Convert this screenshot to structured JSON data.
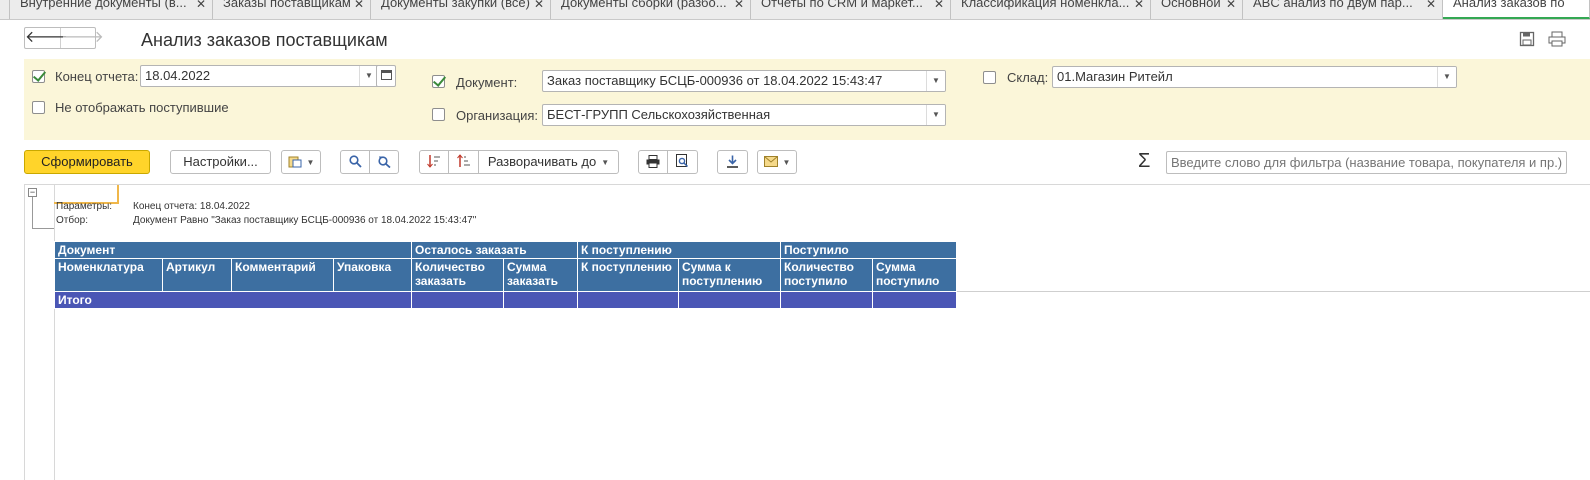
{
  "tabs": [
    {
      "label": "Внутренние документы (в..."
    },
    {
      "label": "Заказы поставщикам"
    },
    {
      "label": "Документы закупки (все)"
    },
    {
      "label": "Документы сборки (разбо..."
    },
    {
      "label": "Отчеты по CRM и маркет..."
    },
    {
      "label": "Классификация номенкла..."
    },
    {
      "label": "Основной"
    },
    {
      "label": "ABC анализ по двум пар..."
    },
    {
      "label": "Анализ заказов по"
    }
  ],
  "header": {
    "title": "Анализ заказов поставщикам",
    "back_glyph": "🡐",
    "fwd_glyph": "🡒"
  },
  "params": {
    "end_date_label": "Конец отчета:",
    "end_date_value": "18.04.2022",
    "end_date_checked": true,
    "hide_received_label": "Не отображать поступившие",
    "hide_received_checked": false,
    "document_label": "Документ:",
    "document_value": "Заказ поставщику БСЦБ-000936 от 18.04.2022 15:43:47",
    "document_checked": true,
    "org_label": "Организация:",
    "org_value": "БЕСТ-ГРУПП Сельскохозяйственная",
    "org_checked": false,
    "warehouse_label": "Склад:",
    "warehouse_value": "01.Магазин Ритейл",
    "warehouse_checked": false
  },
  "toolbar": {
    "generate_label": "Сформировать",
    "settings_label": "Настройки...",
    "expand_label": "Разворачивать до",
    "filter_placeholder": "Введите слово для фильтра (название товара, покупателя и пр.)",
    "sigma": "Σ"
  },
  "report": {
    "params_caption": "Параметры:",
    "params_value": "Конец отчета: 18.04.2022",
    "filter_caption": "Отбор:",
    "filter_value": "Документ Равно \"Заказ поставщику БСЦБ-000936 от 18.04.2022 15:43:47\"",
    "group_headers": {
      "document": "Документ",
      "remaining": "Осталось заказать",
      "to_receive": "К поступлению",
      "received": "Поступило"
    },
    "columns": {
      "nomenclature": "Номенклатура",
      "article": "Артикул",
      "comment": "Комментарий",
      "package": "Упаковка",
      "qty_order": "Количество заказать",
      "sum_order": "Сумма заказать",
      "to_receive": "К поступлению",
      "sum_to_receive": "Сумма к поступлению",
      "qty_received": "Количество поступило",
      "sum_received": "Сумма поступило"
    },
    "total_label": "Итого"
  }
}
